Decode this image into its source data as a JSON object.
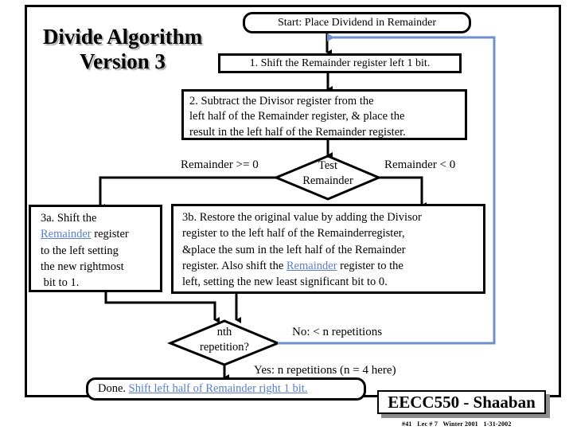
{
  "title": {
    "line1": "Divide Algorithm",
    "line2": "Version 3"
  },
  "flowchart": {
    "start": "Start: Place Dividend in Remainder",
    "step1": "1. Shift the Remainder register left 1 bit.",
    "step2": {
      "line1": "2. Subtract the Divisor register from the",
      "line2": "left half of the Remainder register, & place the",
      "line3": "result in the left half of the Remainder register."
    },
    "test": {
      "line1": "Test",
      "line2": "Remainder",
      "branch_left": "Remainder >= 0",
      "branch_right": "Remainder < 0"
    },
    "step3a": {
      "line1": "3a. Shift the",
      "link": "Remainder",
      "line2_rest": " register",
      "line3": "to the left setting",
      "line4": "the new rightmost",
      "line5": " bit to 1."
    },
    "step3b": {
      "line1": "3b. Restore the original value by adding the Divisor",
      "line2": "register to the left half of the Remainderregister,",
      "line3": "&place the sum in the left half of the Remainder",
      "line4_pre": "register. Also shift the ",
      "link": "Remainder",
      "line4_post": " register to the",
      "line5": "left, setting the new least significant bit to 0."
    },
    "repeat_test": {
      "line1": "nth",
      "line2": "repetition?",
      "no_label": "No: < n repetitions",
      "yes_label": "Yes: n repetitions (n = 4 here)"
    },
    "done": {
      "prefix": "Done. ",
      "link": "Shift left half of Remainder right 1 bit."
    }
  },
  "footer": {
    "course": "EECC550 - Shaaban",
    "info": "#41   Lec # 7   Winter 2001   1-31-2002"
  },
  "colors": {
    "line": "#000000",
    "loop_line": "#6f8fd0",
    "link": "#5b7ec8",
    "shadow": "#8c8c8c"
  }
}
